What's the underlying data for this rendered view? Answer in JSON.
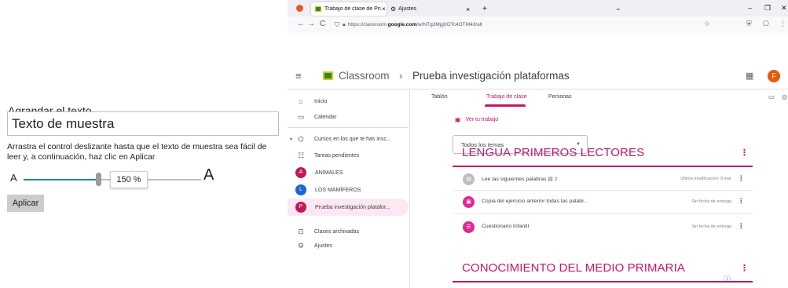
{
  "settings_panel": {
    "title": "Agrandar el texto",
    "sample_text": "Texto de muestra",
    "hint": "Arrastra el control deslizante hasta que el texto de muestra sea fácil de leer y, a continuación, haz clic en Aplicar",
    "label_small": "A",
    "label_large": "A",
    "slider_value": "150 %",
    "slider_fraction": 0.42,
    "apply_label": "Aplicar",
    "accent_color": "#1a8c86"
  },
  "browser": {
    "tabs": [
      {
        "label": "Trabajo de clase de Prueba inv",
        "close": "×",
        "active": true
      },
      {
        "label": "Ajustes",
        "close": "×",
        "active": false
      }
    ],
    "new_tab": "+",
    "window_controls": {
      "minimize": "–",
      "maximize": "❐",
      "close": "✕"
    },
    "nav": {
      "back": "←",
      "forward": "→",
      "reload": "C"
    },
    "url": {
      "prefix": "https://classroom.",
      "domain": "google.com",
      "path": "/w/NTg3Mjg0OTc4OTM4/t/all"
    }
  },
  "classroom": {
    "app_name": "Classroom",
    "breadcrumb_sep": "›",
    "course_title": "Prueba investigación plataformas",
    "avatar_letter": "F",
    "brand_color": "#c5176b",
    "sidebar": {
      "inicio": "Inicio",
      "calendar": "Calendar",
      "enrolled": "Cursos en los que te has insc...",
      "pending": "Tareas pendientes",
      "courses": [
        {
          "letter": "A",
          "label": "ANIMALES",
          "color": "#c2185b"
        },
        {
          "letter": "L",
          "label": "LOS MAMÍFEROS",
          "color": "#1967d2"
        },
        {
          "letter": "P",
          "label": "Prueba investigación platafor...",
          "color": "#c2185b"
        }
      ],
      "archived": "Clases archivadas",
      "settings": "Ajustes"
    },
    "tabs": {
      "stream": "Tablón",
      "classwork": "Trabajo de clase",
      "people": "Personas"
    },
    "view_work": "Ver tu trabajo",
    "topic_filter": "Todos los temas",
    "topics": [
      {
        "title": "LENGUA PRIMEROS LECTORES",
        "items": [
          {
            "title": "Lee las siguientes palabras",
            "attachment_count": "2",
            "meta": "Última modificación: 9 mar",
            "kind": "material"
          },
          {
            "title": "Copia del ejercicio anterior todas las palabr...",
            "meta": "Sin fecha de entrega",
            "kind": "assignment"
          },
          {
            "title": "Cuestionario Infantil",
            "meta": "Sin fecha de entrega",
            "kind": "quiz"
          }
        ]
      },
      {
        "title": "CONOCIMIENTO DEL MEDIO PRIMARIA",
        "items": []
      }
    ]
  }
}
